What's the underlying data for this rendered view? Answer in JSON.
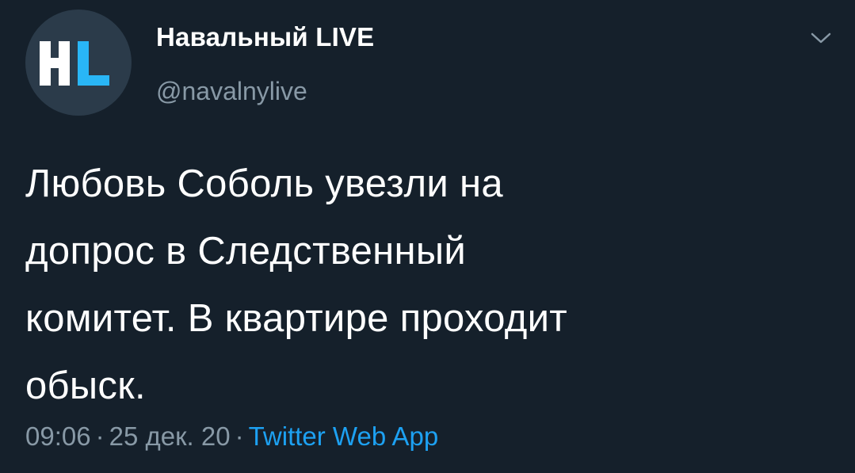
{
  "author": {
    "name": "Навальный LIVE",
    "handle": "@navalnylive",
    "avatar_letters": "HL",
    "avatar_colors": {
      "background": "#2b3b4a",
      "left_letter": "#ffffff",
      "right_letter": "#29b6f6"
    }
  },
  "more_icon": "chevron-down-icon",
  "tweet": {
    "lines": [
      "Любовь Соболь увезли на",
      "допрос в Следственный",
      "комитет. В квартире проходит",
      "обыск."
    ]
  },
  "meta": {
    "time": "09:06",
    "separator": "·",
    "date": "25 дек. 20",
    "source": "Twitter Web App"
  },
  "colors": {
    "background": "#15202b",
    "text_primary": "#ffffff",
    "text_secondary": "#8899a6",
    "link": "#1da1f2"
  }
}
